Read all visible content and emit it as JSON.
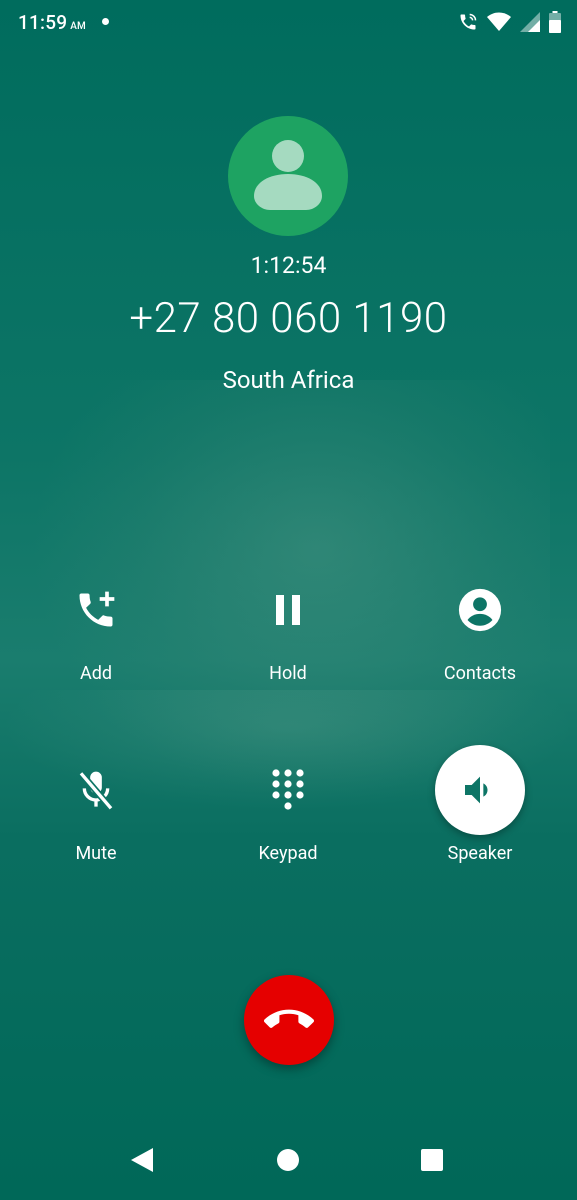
{
  "status_bar": {
    "time": "11:59",
    "ampm": "AM",
    "icons": [
      "notification-dot",
      "wifi-call-icon",
      "wifi-icon",
      "signal-icon",
      "battery-icon"
    ]
  },
  "call": {
    "timer": "1:12:54",
    "number": "+27 80 060 1190",
    "location": "South Africa"
  },
  "controls": {
    "add": "Add",
    "hold": "Hold",
    "contacts": "Contacts",
    "mute": "Mute",
    "keypad": "Keypad",
    "speaker": "Speaker"
  },
  "colors": {
    "background": "#006c5d",
    "avatar": "#1ea362",
    "end_call": "#e50000",
    "speaker_active_bg": "#ffffff"
  },
  "nav": [
    "back-icon",
    "home-icon",
    "recents-icon"
  ]
}
